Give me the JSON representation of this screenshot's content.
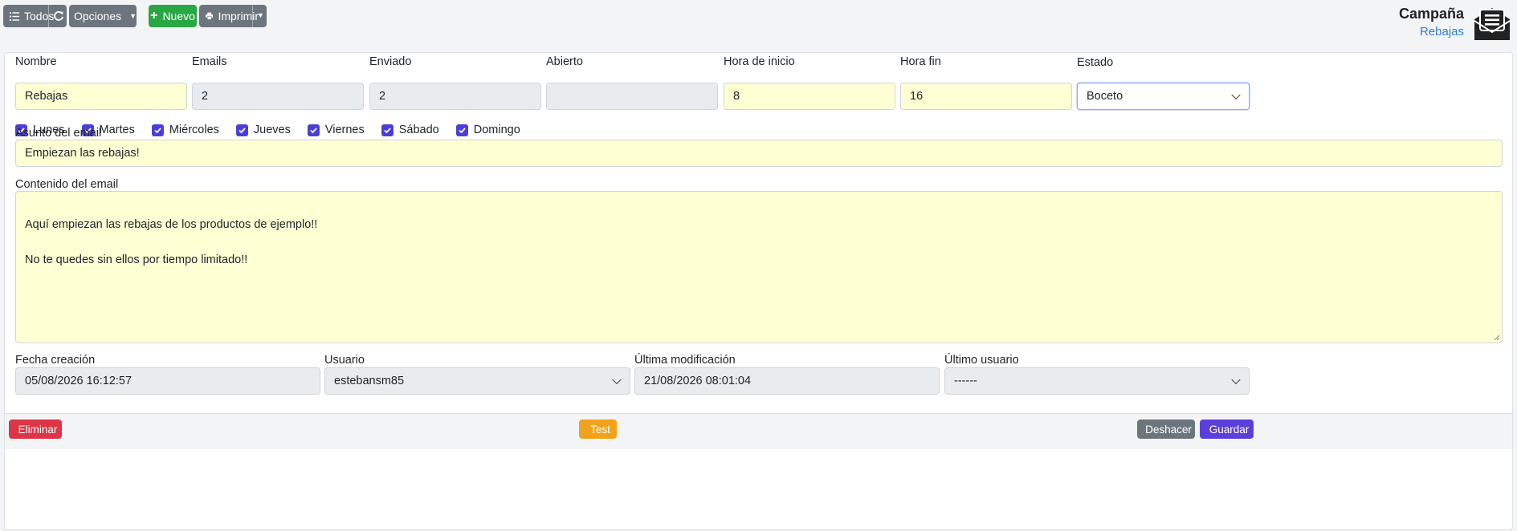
{
  "toolbar": {
    "all_label": "Todos",
    "options_label": "Opciones",
    "new_label": "Nuevo",
    "print_label": "Imprimir"
  },
  "header": {
    "title": "Campaña",
    "subtitle": "Rebajas"
  },
  "form": {
    "nombre": {
      "label": "Nombre",
      "value": "Rebajas"
    },
    "emails": {
      "label": "Emails",
      "value": "2"
    },
    "enviado": {
      "label": "Enviado",
      "value": "2"
    },
    "abierto": {
      "label": "Abierto",
      "value": ""
    },
    "hora_inicio": {
      "label": "Hora de inicio",
      "value": "8"
    },
    "hora_fin": {
      "label": "Hora fin",
      "value": "16"
    },
    "estado": {
      "label": "Estado",
      "value": "Boceto"
    },
    "days": [
      {
        "label": "Lunes",
        "checked": true
      },
      {
        "label": "Martes",
        "checked": true
      },
      {
        "label": "Miércoles",
        "checked": true
      },
      {
        "label": "Jueves",
        "checked": true
      },
      {
        "label": "Viernes",
        "checked": true
      },
      {
        "label": "Sábado",
        "checked": true
      },
      {
        "label": "Domingo",
        "checked": true
      }
    ],
    "asunto": {
      "label": "Asunto del email",
      "value": "Empiezan las rebajas!"
    },
    "contenido": {
      "label": "Contenido del email",
      "line1": "Aquí empiezan las rebajas de los productos de ejemplo!!",
      "line2": "No te quedes sin ellos por tiempo limitado!!"
    },
    "fecha_creacion": {
      "label": "Fecha creación",
      "value": "05/08/2026 16:12:57"
    },
    "usuario": {
      "label": "Usuario",
      "value": "estebansm85"
    },
    "ultima_modificacion": {
      "label": "Última modificación",
      "value": "21/08/2026 08:01:04"
    },
    "ultimo_usuario": {
      "label": "Último usuario",
      "value": "------"
    }
  },
  "footer": {
    "delete_label": "Eliminar",
    "test_label": "Test",
    "undo_label": "Deshacer",
    "save_label": "Guardar"
  },
  "colors": {
    "yellow_field": "#ffffd4",
    "readonly_field": "#e9ecef",
    "primary": "#5b3fd9",
    "success": "#28a745",
    "danger": "#dc3545",
    "warning": "#f0a21a",
    "secondary": "#6c757d",
    "link": "#2f80d1"
  }
}
